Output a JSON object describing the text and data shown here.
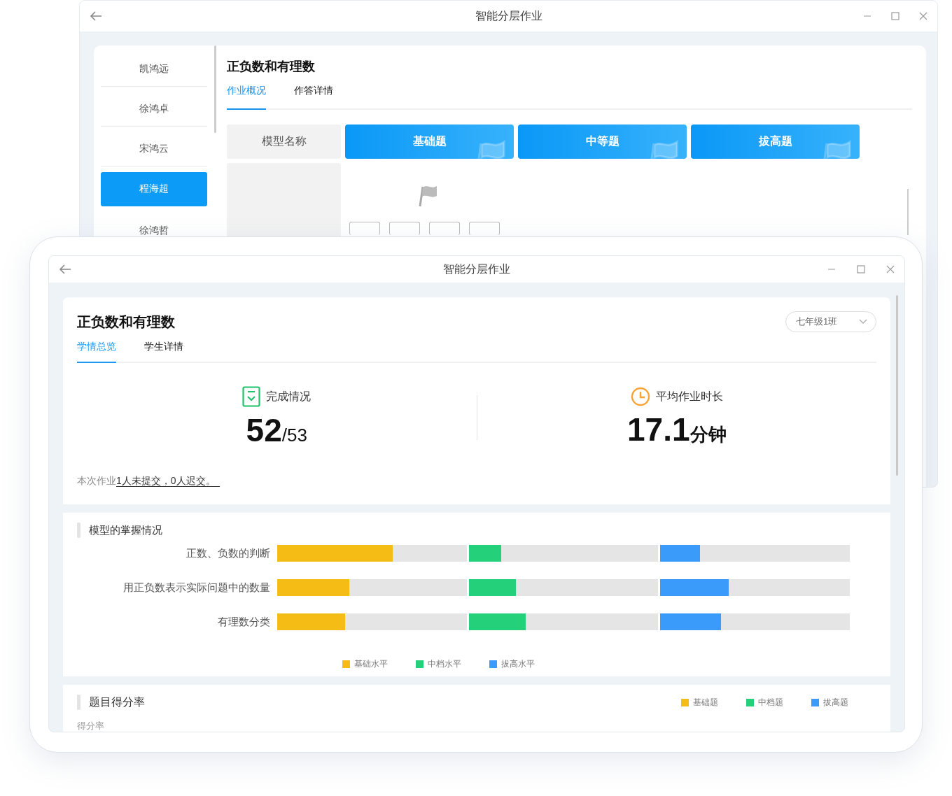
{
  "back_window": {
    "title": "智能分层作业",
    "students": [
      {
        "name": "凯鸿远",
        "selected": false
      },
      {
        "name": "徐鸿卓",
        "selected": false
      },
      {
        "name": "宋鸿云",
        "selected": false
      },
      {
        "name": "程海超",
        "selected": true
      },
      {
        "name": "徐鸿哲",
        "selected": false
      }
    ],
    "heading": "正负数和有理数",
    "tabs": [
      {
        "label": "作业概况",
        "selected": true
      },
      {
        "label": "作答详情",
        "selected": false
      }
    ],
    "table": {
      "header": "模型名称",
      "levels": [
        "基础题",
        "中等题",
        "拔高题"
      ]
    }
  },
  "front_window": {
    "title": "智能分层作业",
    "heading": "正负数和有理数",
    "class_select": "七年级1班",
    "tabs": [
      {
        "label": "学情总览",
        "selected": true
      },
      {
        "label": "学生详情",
        "selected": false
      }
    ],
    "stats": [
      {
        "kind": "completion",
        "label": "完成情况",
        "value": "52",
        "suffix": "/53"
      },
      {
        "kind": "duration",
        "label": "平均作业时长",
        "value": "17.1",
        "suffix": "分钟"
      }
    ],
    "note": {
      "prefix": "本次作业",
      "link": "1人未提交，0人迟交。"
    },
    "mastery": {
      "title": "模型的掌握情况",
      "rows": [
        {
          "label": "正数、负数的判断",
          "segments": [
            {
              "level": 0.61,
              "color": "#f5bc16"
            },
            {
              "level": 0.17,
              "color": "#24d07a"
            },
            {
              "level": 0.21,
              "color": "#3a9bfa"
            }
          ]
        },
        {
          "label": "用正负数表示实际问题中的数量",
          "segments": [
            {
              "level": 0.38,
              "color": "#f5bc16"
            },
            {
              "level": 0.25,
              "color": "#24d07a"
            },
            {
              "level": 0.36,
              "color": "#3a9bfa"
            }
          ]
        },
        {
          "label": "有理数分类",
          "segments": [
            {
              "level": 0.36,
              "color": "#f5bc16"
            },
            {
              "level": 0.3,
              "color": "#24d07a"
            },
            {
              "level": 0.32,
              "color": "#3a9bfa"
            }
          ]
        }
      ],
      "legend": [
        {
          "label": "基础水平",
          "color": "#f5bc16"
        },
        {
          "label": "中档水平",
          "color": "#24d07a"
        },
        {
          "label": "拔高水平",
          "color": "#3a9bfa"
        }
      ]
    },
    "score_rate": {
      "title": "题目得分率",
      "axis_label": "得分率",
      "legend": [
        {
          "label": "基础题",
          "color": "#f5bc16"
        },
        {
          "label": "中档题",
          "color": "#24d07a"
        },
        {
          "label": "拔高题",
          "color": "#3a9bfa"
        }
      ]
    }
  }
}
